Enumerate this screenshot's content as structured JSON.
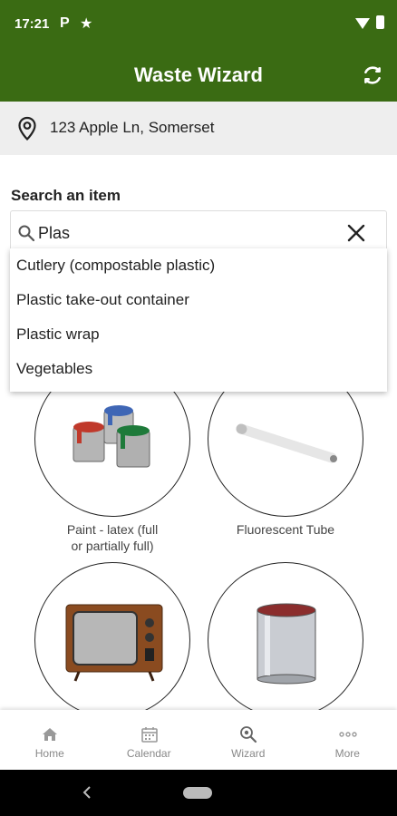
{
  "status_bar": {
    "time": "17:21",
    "notification_p": "P",
    "notification_star": "★"
  },
  "app_bar": {
    "title": "Waste Wizard",
    "refresh_icon": "refresh-icon"
  },
  "location": {
    "address": "123 Apple Ln, Somerset",
    "icon": "location-pin-icon"
  },
  "search": {
    "label": "Search an item",
    "value": "Plas",
    "suggestions": [
      "Cutlery (compostable plastic)",
      "Plastic take-out container",
      "Plastic wrap",
      "Vegetables"
    ]
  },
  "grid": {
    "items": [
      {
        "label_line1": "Paint - latex (full",
        "label_line2": "or partially full)",
        "image": "paint-cans"
      },
      {
        "label_line1": "Fluorescent Tube",
        "label_line2": "",
        "image": "fluorescent-tube"
      },
      {
        "label_line1": "",
        "label_line2": "",
        "image": "television"
      },
      {
        "label_line1": "",
        "label_line2": "",
        "image": "paint-can"
      }
    ]
  },
  "bottom_nav": {
    "items": [
      {
        "label": "Home",
        "icon": "home-icon"
      },
      {
        "label": "Calendar",
        "icon": "calendar-icon"
      },
      {
        "label": "Wizard",
        "icon": "wizard-search-icon"
      },
      {
        "label": "More",
        "icon": "more-icon"
      }
    ]
  },
  "colors": {
    "primary": "#3a6b13",
    "location_bg": "#eeeeee",
    "nav_label": "#888888"
  }
}
